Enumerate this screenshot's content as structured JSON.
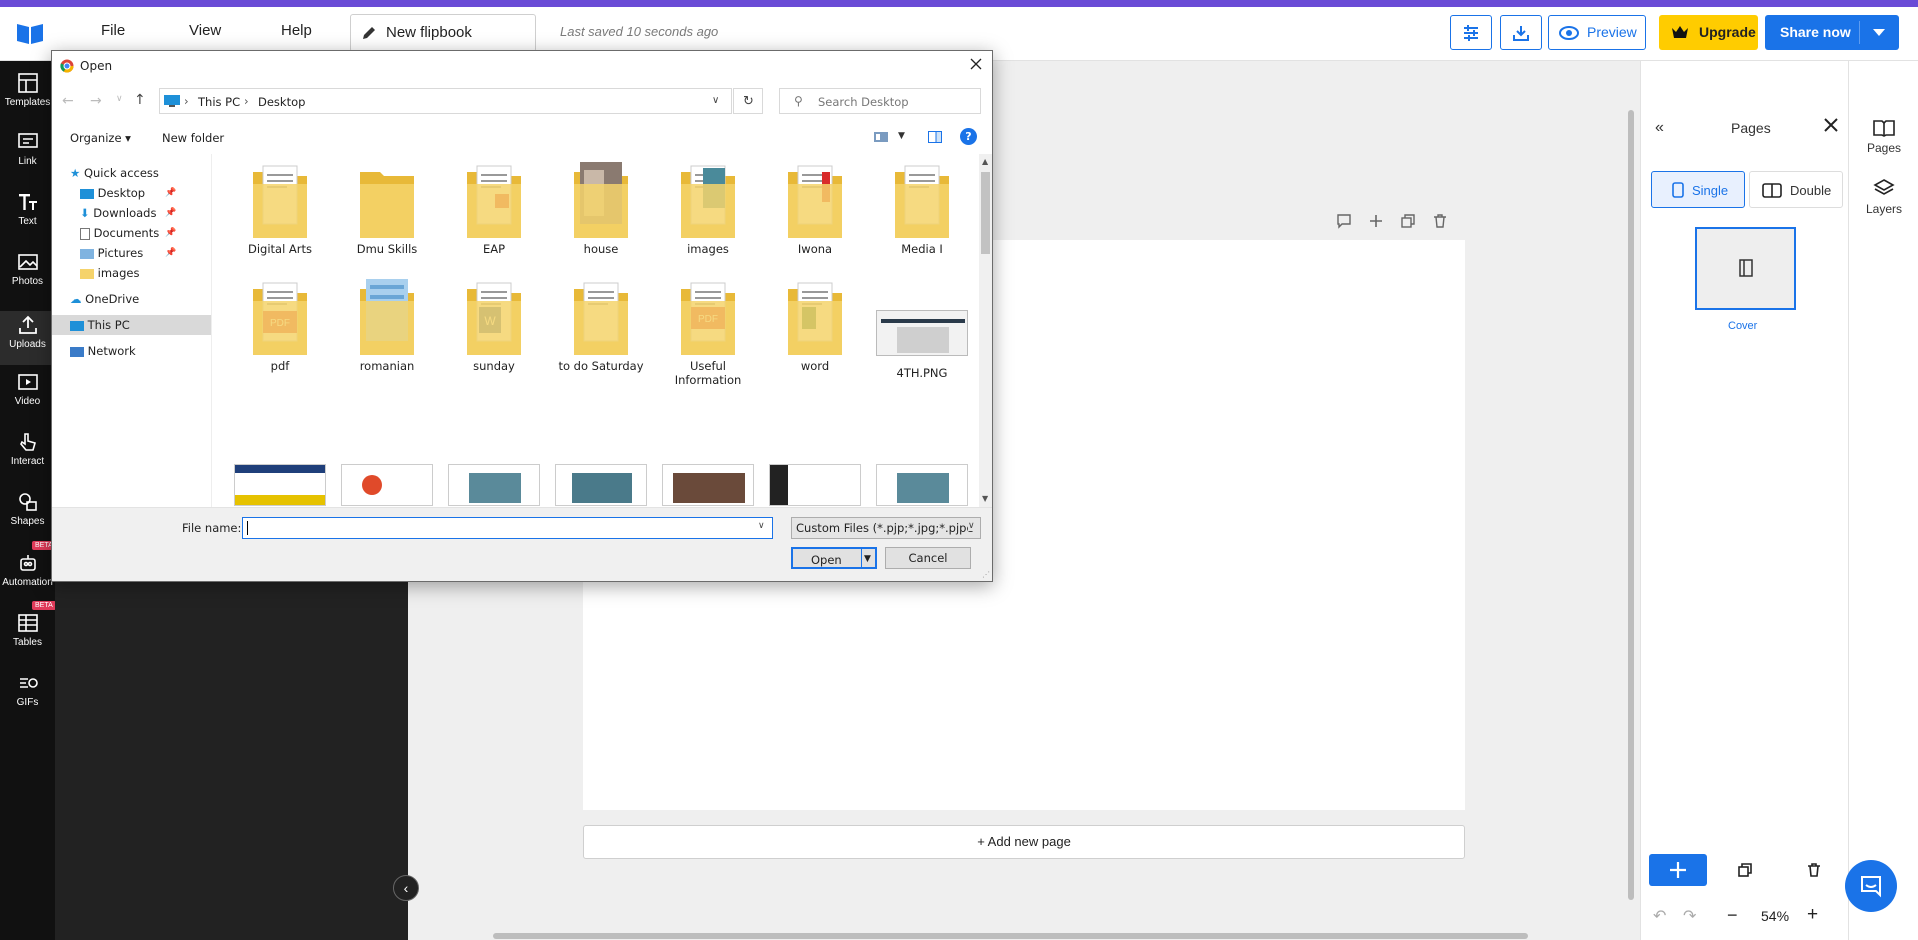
{
  "app": {
    "menu": [
      "File",
      "View",
      "Help"
    ],
    "title": "New flipbook",
    "saved": "Last saved 10 seconds ago",
    "preview": "Preview",
    "upgrade": "Upgrade",
    "share": "Share now",
    "accent": "#1a73e8",
    "brand_stripe": "#6a4bd6",
    "upgrade_color": "#ffcc00"
  },
  "sidebar": {
    "items": [
      {
        "label": "Templates",
        "icon": "templates-icon"
      },
      {
        "label": "Link",
        "icon": "link-icon"
      },
      {
        "label": "Text",
        "icon": "text-icon"
      },
      {
        "label": "Photos",
        "icon": "photos-icon"
      },
      {
        "label": "Uploads",
        "icon": "uploads-icon"
      },
      {
        "label": "Video",
        "icon": "video-icon"
      },
      {
        "label": "Interact",
        "icon": "interact-icon"
      },
      {
        "label": "Shapes",
        "icon": "shapes-icon"
      },
      {
        "label": "Automation",
        "icon": "automation-icon",
        "badge": "BETA"
      },
      {
        "label": "Tables",
        "icon": "tables-icon",
        "badge": "BETA"
      },
      {
        "label": "GIFs",
        "icon": "gifs-icon"
      }
    ]
  },
  "canvas": {
    "add_page": "+ Add new page"
  },
  "pages_panel": {
    "title": "Pages",
    "single": "Single",
    "double": "Double",
    "cover": "Cover",
    "zoom": "54%"
  },
  "rightbar": {
    "pages": "Pages",
    "layers": "Layers"
  },
  "dialog": {
    "title": "Open",
    "path": [
      "This PC",
      "Desktop"
    ],
    "search_placeholder": "Search Desktop",
    "organize": "Organize",
    "new_folder": "New folder",
    "nav": {
      "quick_access": "Quick access",
      "pinned": [
        "Desktop",
        "Downloads",
        "Documents",
        "Pictures"
      ],
      "images": "images",
      "onedrive": "OneDrive",
      "this_pc": "This PC",
      "network": "Network"
    },
    "row1": [
      "Digital Arts",
      "Dmu Skills",
      "EAP",
      "house",
      "images",
      "Iwona",
      "Media I"
    ],
    "row2": [
      "pdf",
      "romanian",
      "sunday",
      "to do Saturday",
      "Useful Information",
      "word",
      "4TH.PNG"
    ],
    "file_name_label": "File name:",
    "file_name_value": "",
    "filter": "Custom Files (*.pjp;*.jpg;*.pjpe",
    "open": "Open",
    "cancel": "Cancel"
  }
}
